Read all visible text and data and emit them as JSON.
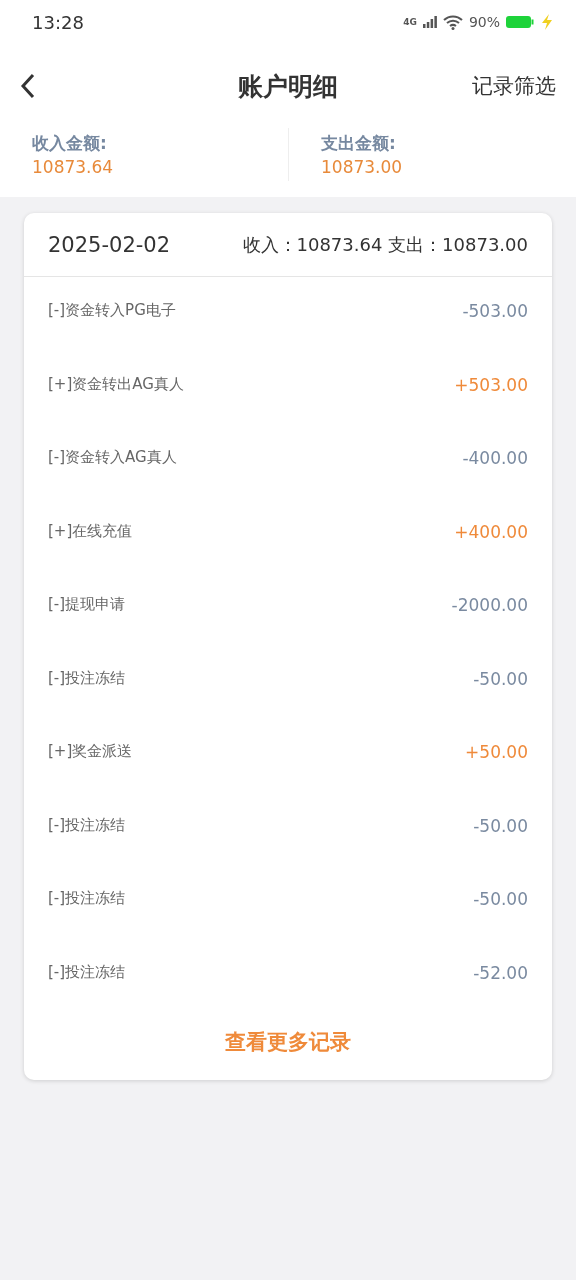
{
  "status_bar": {
    "time": "13:28",
    "network": "4G",
    "battery": "90%"
  },
  "header": {
    "title": "账户明细",
    "action": "记录筛选"
  },
  "summary": [
    {
      "label": "收入金额:",
      "amount": "10873.64"
    },
    {
      "label": "支出金额:",
      "amount": "10873.00"
    }
  ],
  "day": {
    "date": "2025-02-02",
    "totals": "收入：10873.64 支出：10873.00",
    "records": [
      {
        "kind": "expense",
        "label": "[-]资金转入PG电子",
        "amount": "-503.00"
      },
      {
        "kind": "income",
        "label": "[+]资金转出AG真人",
        "amount": "+503.00"
      },
      {
        "kind": "expense",
        "label": "[-]资金转入AG真人",
        "amount": "-400.00"
      },
      {
        "kind": "income",
        "label": "[+]在线充值",
        "amount": "+400.00"
      },
      {
        "kind": "expense",
        "label": "[-]提现申请",
        "amount": "-2000.00"
      },
      {
        "kind": "expense",
        "label": "[-]投注冻结",
        "amount": "-50.00"
      },
      {
        "kind": "income",
        "label": "[+]奖金派送",
        "amount": "+50.00"
      },
      {
        "kind": "expense",
        "label": "[-]投注冻结",
        "amount": "-50.00"
      },
      {
        "kind": "expense",
        "label": "[-]投注冻结",
        "amount": "-50.00"
      },
      {
        "kind": "expense",
        "label": "[-]投注冻结",
        "amount": "-52.00"
      }
    ],
    "more": "查看更多记录"
  }
}
